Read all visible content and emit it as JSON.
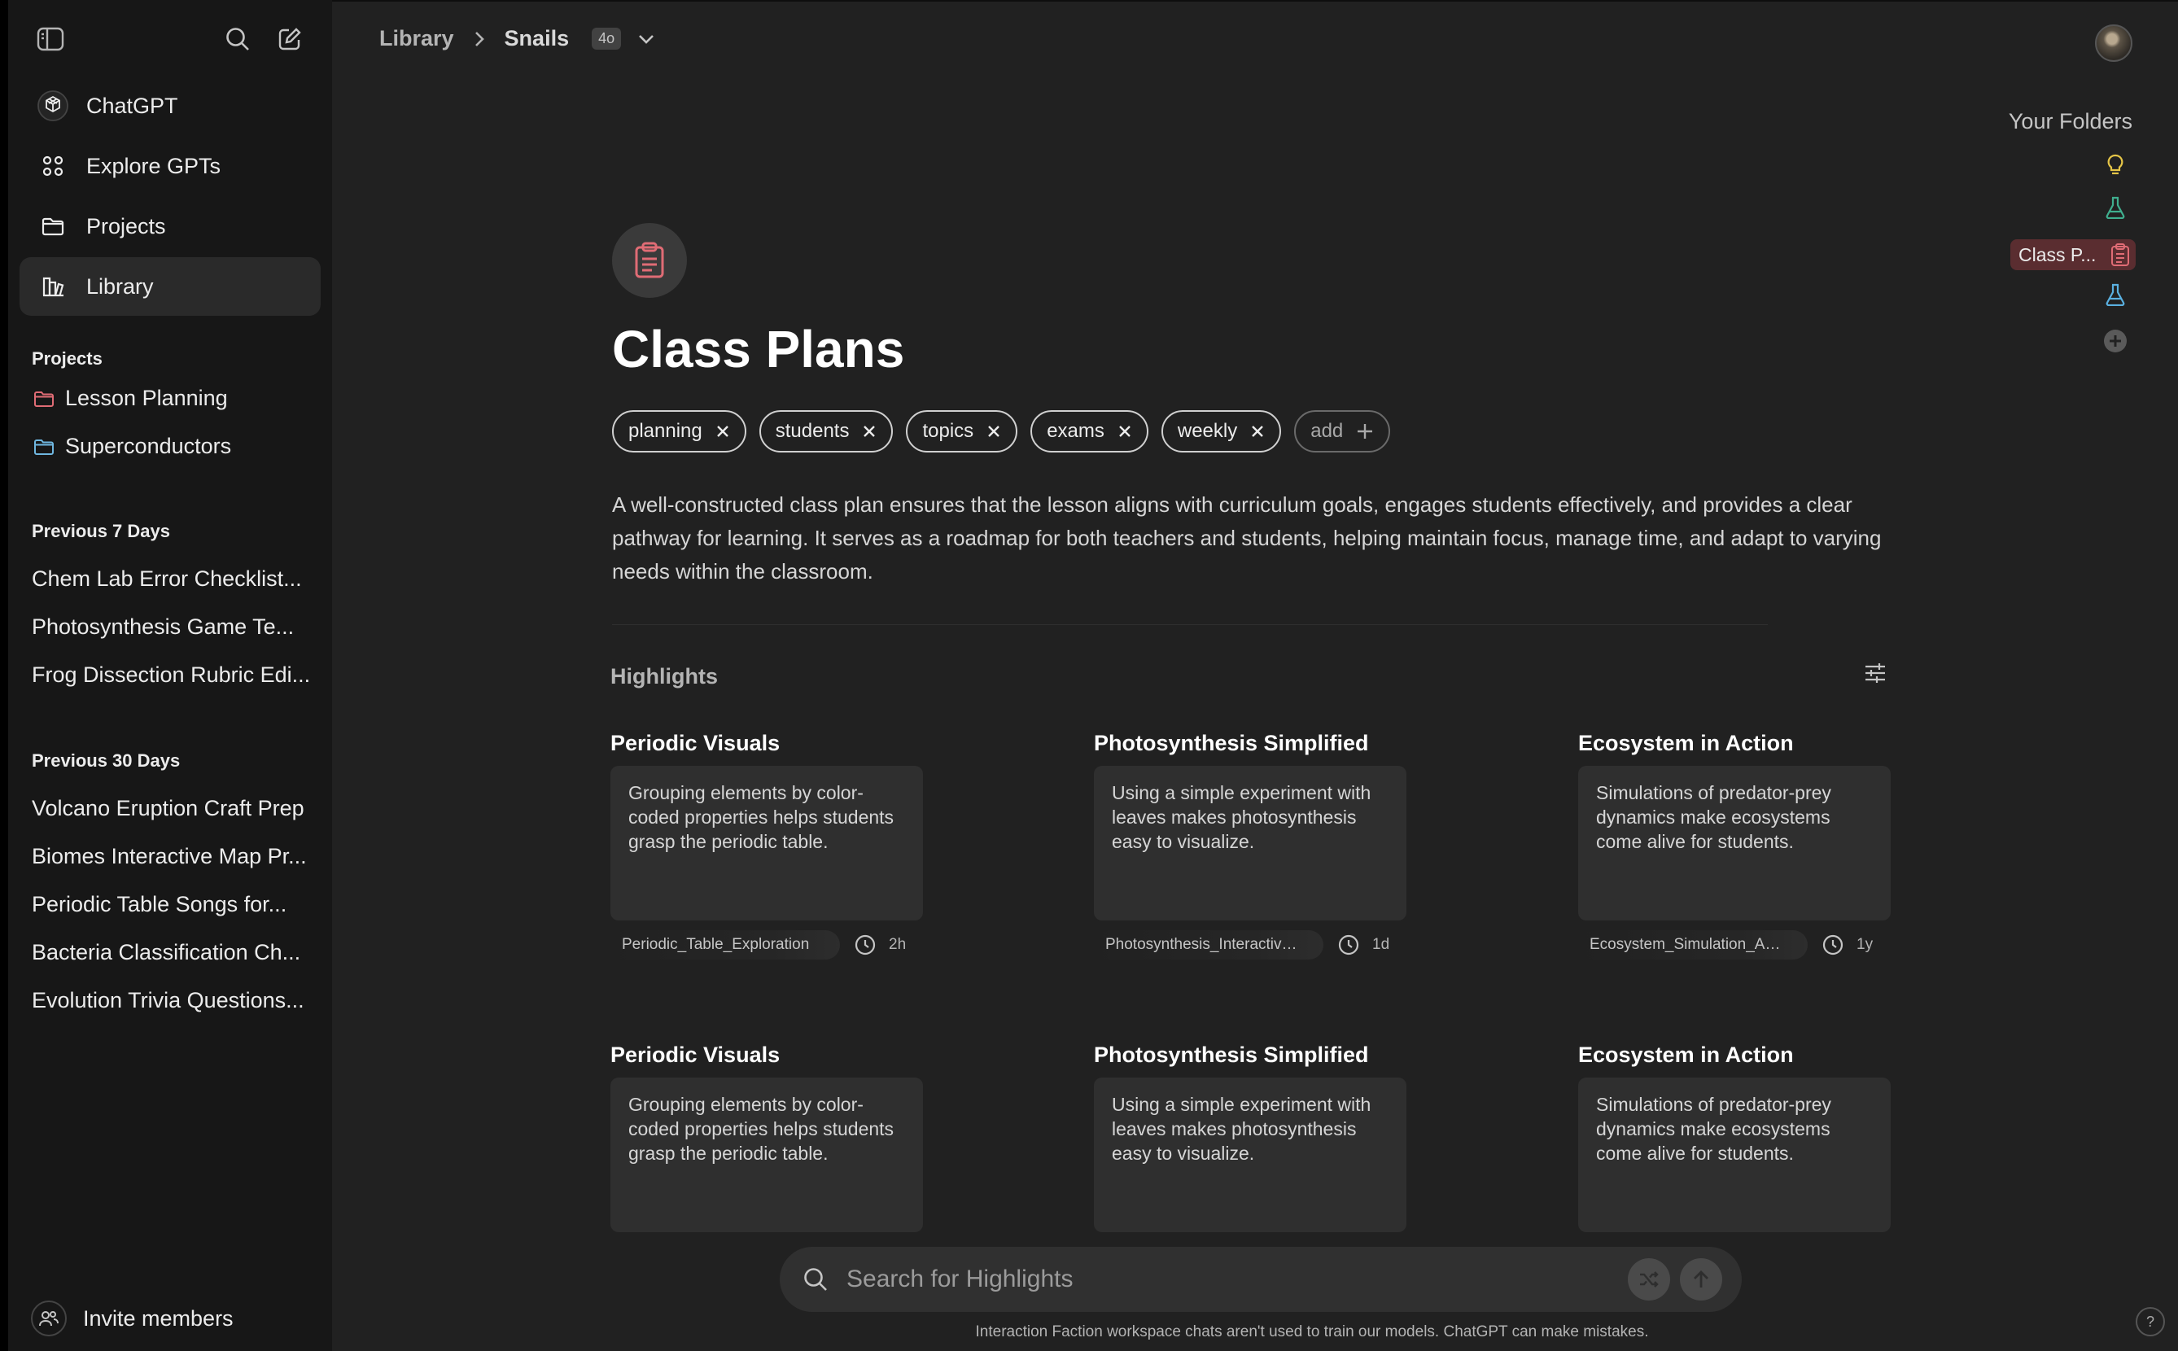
{
  "sidebar": {
    "nav": [
      {
        "label": "ChatGPT",
        "icon": "openai-logo-icon"
      },
      {
        "label": "Explore GPTs",
        "icon": "grid-icon"
      },
      {
        "label": "Projects",
        "icon": "folder-icon"
      },
      {
        "label": "Library",
        "icon": "library-icon"
      }
    ],
    "projects_title": "Projects",
    "projects": [
      {
        "label": "Lesson Planning",
        "color": "#e06c75"
      },
      {
        "label": "Superconductors",
        "color": "#6fb7e0"
      }
    ],
    "prev7_title": "Previous 7 Days",
    "prev7": [
      "Chem Lab Error Checklist...",
      "Photosynthesis Game Te...",
      "Frog Dissection Rubric Edi..."
    ],
    "prev30_title": "Previous 30 Days",
    "prev30": [
      "Volcano Eruption Craft Prep",
      "Biomes Interactive Map Pr...",
      "Periodic Table Songs for...",
      "Bacteria Classification Ch...",
      "Evolution Trivia Questions..."
    ],
    "invite_label": "Invite members"
  },
  "header": {
    "crumb1": "Library",
    "crumb2": "Snails",
    "model_badge": "4o"
  },
  "folders": {
    "title": "Your Folders",
    "active_label": "Class P...",
    "colors": {
      "bulb": "#e5c547",
      "flask": "#3fae8e",
      "active": "#e06c75",
      "flask2": "#5ab0e0"
    }
  },
  "page": {
    "title": "Class Plans",
    "tags": [
      "planning",
      "students",
      "topics",
      "exams",
      "weekly"
    ],
    "add_label": "add",
    "description": "A well-constructed class plan ensures that the lesson aligns with curriculum goals, engages students effectively, and provides a clear pathway for learning. It serves as a roadmap for both teachers and students, helping maintain focus, manage time, and adapt to varying needs within the classroom.",
    "highlights_title": "Highlights"
  },
  "cards": [
    {
      "title": "Periodic Visuals",
      "body": "Grouping elements by color-coded properties helps students grasp the periodic table.",
      "file": "Periodic_Table_Exploration",
      "time": "2h"
    },
    {
      "title": "Photosynthesis Simplified",
      "body": "Using a simple experiment with leaves makes photosynthesis easy to visualize.",
      "file": "Photosynthesis_Interactive_Lesson",
      "time": "1d"
    },
    {
      "title": "Ecosystem in Action",
      "body": "Simulations of predator-prey dynamics make ecosystems come alive for students.",
      "file": "Ecosystem_Simulation_Activity",
      "time": "1y"
    },
    {
      "title": "Periodic Visuals",
      "body": "Grouping elements by color-coded properties helps students grasp the periodic table."
    },
    {
      "title": "Photosynthesis Simplified",
      "body": "Using a simple experiment with leaves makes photosynthesis easy to visualize."
    },
    {
      "title": "Ecosystem in Action",
      "body": "Simulations of predator-prey dynamics make ecosystems come alive for students."
    }
  ],
  "search": {
    "placeholder": "Search for Highlights"
  },
  "footer": {
    "note": "Interaction Faction workspace chats aren't used to train our models. ChatGPT can make mistakes.",
    "help": "?"
  }
}
